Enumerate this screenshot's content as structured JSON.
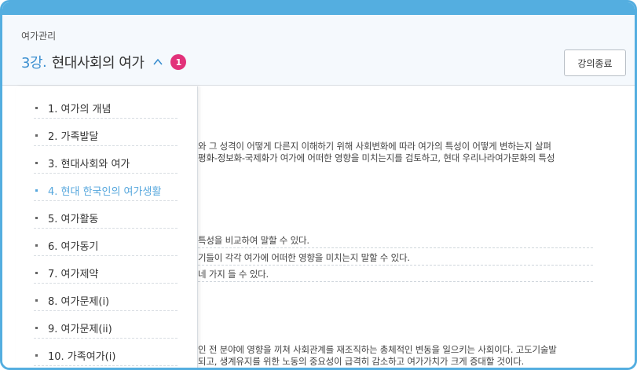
{
  "header": {
    "breadcrumb": "여가관리",
    "lesson_number": "3강",
    "lesson_dot": ".",
    "lesson_title": "현대사회의 여가",
    "badge": "1",
    "end_button": "강의종료",
    "chevron_icon": "chevron-up-icon"
  },
  "colors": {
    "accent": "#54aee0",
    "active_menu": "#56a7dd",
    "badge": "#e2327a"
  },
  "menu": {
    "items": [
      {
        "label": "1. 여가의 개념",
        "active": false
      },
      {
        "label": "2. 가족발달",
        "active": false
      },
      {
        "label": "3. 현대사회와 여가",
        "active": false
      },
      {
        "label": "4. 현대 한국인의 여가생활",
        "active": true
      },
      {
        "label": "5. 여가활동",
        "active": false
      },
      {
        "label": "6. 여가동기",
        "active": false
      },
      {
        "label": "7. 여가제약",
        "active": false
      },
      {
        "label": "8. 여가문제(i)",
        "active": false
      },
      {
        "label": "9. 여가문제(ii)",
        "active": false
      },
      {
        "label": "10. 가족여가(i)",
        "active": false
      }
    ]
  },
  "content": {
    "intro_line1": "와 그 성격이 어떻게 다른지 이해하기 위해 사회변화에 따라 여가의 특성이 어떻게 변하는지 살펴",
    "intro_line2": "평화-정보화-국제화가 여가에 어떠한 영향을 미치는지를 검토하고, 현대 우리나라여가문화의 특성",
    "goal1": "특성을 비교하여 말할 수 있다.",
    "goal2": "기들이 각각 여가에 어떠한 영향을 미치는지 말할 수 있다.",
    "goal3": "네 가지 들 수 있다.",
    "body_line1": "인 전 분야에 영향을 끼쳐 사회관계를 재조직하는 총체적인 변동을 일으키는 사회이다. 고도기술발",
    "body_line2": "되고, 생계유지를 위한 노동의 중요성이 급격히 감소하고 여가가치가 크게 증대할 것이다."
  }
}
